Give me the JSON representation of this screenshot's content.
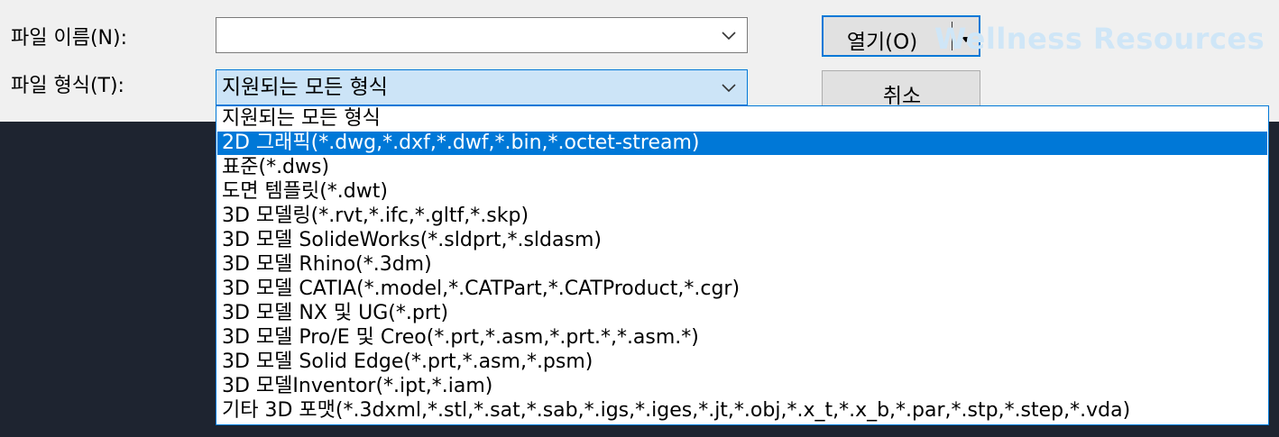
{
  "dialog": {
    "filename_label": "파일 이름(N):",
    "filename_value": "",
    "filetype_label": "파일 형식(T):",
    "filetype_value": "지원되는 모든 형식",
    "open_button": "열기(O)",
    "cancel_button": "취소"
  },
  "watermark": "Wellness Resources",
  "filetype_options": [
    "지원되는 모든 형식",
    "2D 그래픽(*.dwg,*.dxf,*.dwf,*.bin,*.octet-stream)",
    "표준(*.dws)",
    "도면 템플릿(*.dwt)",
    "3D 모델링(*.rvt,*.ifc,*.gltf,*.skp)",
    "3D 모델 SolideWorks(*.sldprt,*.sldasm)",
    "3D 모델 Rhino(*.3dm)",
    "3D 모델 CATIA(*.model,*.CATPart,*.CATProduct,*.cgr)",
    "3D 모델 NX 및 UG(*.prt)",
    "3D 모델 Pro/E 및 Creo(*.prt,*.asm,*.prt.*,*.asm.*)",
    "3D 모델 Solid Edge(*.prt,*.asm,*.psm)",
    "3D 모델Inventor(*.ipt,*.iam)",
    "기타 3D 포맷(*.3dxml,*.stl,*.sat,*.sab,*.igs,*.iges,*.jt,*.obj,*.x_t,*.x_b,*.par,*.stp,*.step,*.vda)"
  ],
  "selected_option_index": 1,
  "colors": {
    "accent": "#0078d7",
    "dark_background": "#1e2430"
  },
  "icons": {
    "combo_arrow": "chevron-down-icon",
    "split_arrow": "caret-down-icon"
  }
}
